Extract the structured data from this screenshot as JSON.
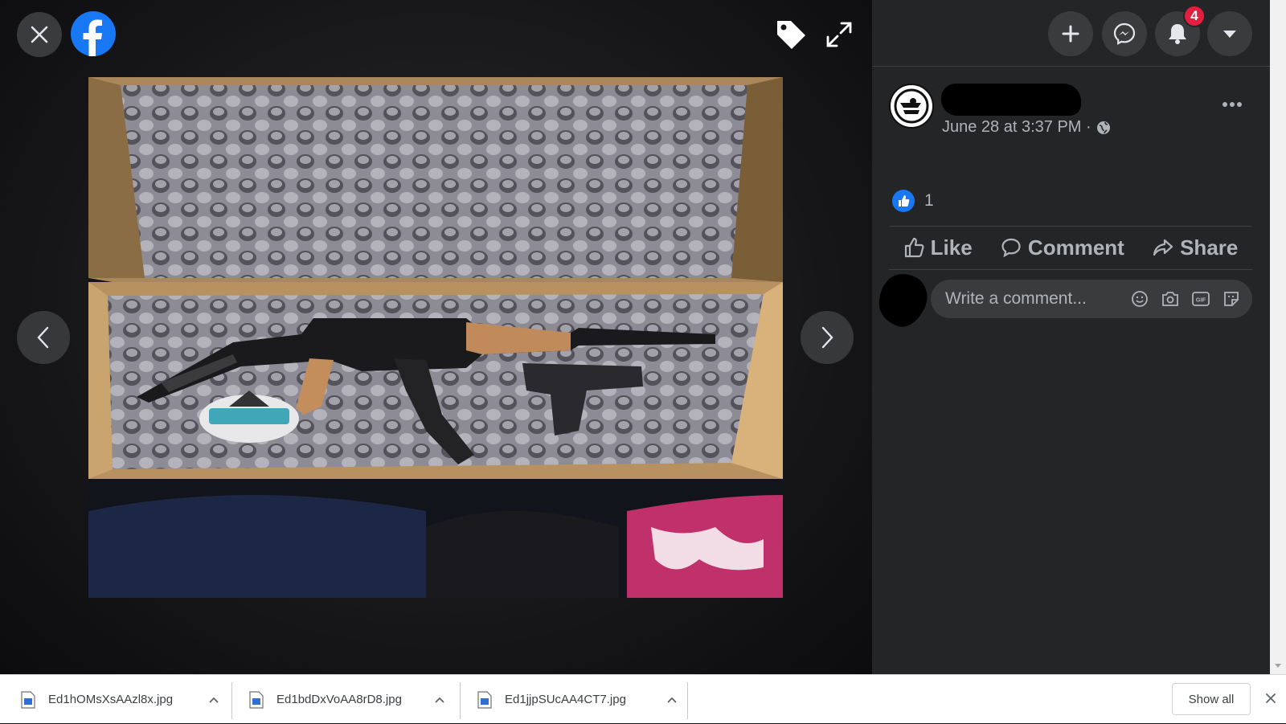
{
  "viewer": {
    "close_icon": "close-icon",
    "logo_icon": "facebook-logo",
    "tag_icon": "tag-icon",
    "fullscreen_icon": "expand-icon",
    "prev_icon": "chevron-left-icon",
    "next_icon": "chevron-right-icon",
    "logo_color": "#1877f2"
  },
  "header": {
    "icons": [
      "plus-icon",
      "messenger-icon",
      "bell-icon",
      "caret-down-icon"
    ],
    "notification_count": "4",
    "badge_color": "#e41e3f"
  },
  "post": {
    "time": "June 28 at 3:37 PM ·",
    "privacy_icon": "globe-icon",
    "reaction_count": "1",
    "actions": {
      "like": "Like",
      "comment": "Comment",
      "share": "Share"
    },
    "comment_placeholder": "Write a comment...",
    "comment_tools": [
      "emoji-icon",
      "camera-icon",
      "gif-icon",
      "sticker-icon"
    ]
  },
  "downloads": {
    "items": [
      {
        "name": "Ed1hOMsXsAAzl8x.jpg"
      },
      {
        "name": "Ed1bdDxVoAA8rD8.jpg"
      },
      {
        "name": "Ed1jjpSUcAA4CT7.jpg"
      }
    ],
    "show_all": "Show all"
  }
}
